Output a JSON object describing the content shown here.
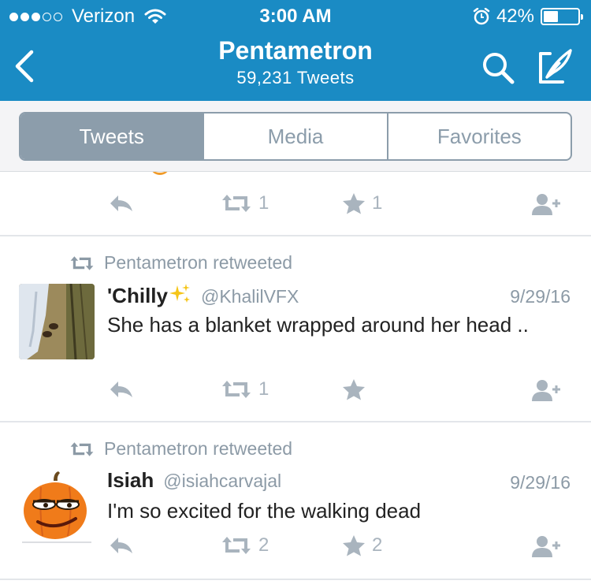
{
  "status": {
    "carrier": "Verizon",
    "time": "3:00 AM",
    "battery": "42%",
    "battery_level": 0.42
  },
  "nav": {
    "title": "Pentametron",
    "subtitle": "59,231 Tweets"
  },
  "tabs": [
    {
      "label": "Tweets",
      "active": true
    },
    {
      "label": "Media",
      "active": false
    },
    {
      "label": "Favorites",
      "active": false
    }
  ],
  "partial_tweet": {
    "retweets": "1",
    "likes": "1"
  },
  "tweets": [
    {
      "retweeted_by": "Pentametron retweeted",
      "name": "'Chilly",
      "handle": "@KhalilVFX",
      "date": "9/29/16",
      "text": "She has a blanket wrapped around her head ..",
      "retweets": "1",
      "likes": ""
    },
    {
      "retweeted_by": "Pentametron retweeted",
      "name": "Isiah",
      "handle": "@isiahcarvajal",
      "date": "9/29/16",
      "text": "I'm so excited for the walking dead",
      "retweets": "2",
      "likes": "2"
    }
  ],
  "icons": {
    "back": "chevron-left-icon",
    "search": "search-icon",
    "compose": "compose-icon",
    "reply": "reply-icon",
    "retweet": "retweet-icon",
    "favorite": "star-icon",
    "follow": "follow-user-icon",
    "sparkles": "sparkles-emoji"
  },
  "colors": {
    "header": "#1a8bc4",
    "segment": "#8c9dab",
    "muted": "#a9b4be"
  }
}
